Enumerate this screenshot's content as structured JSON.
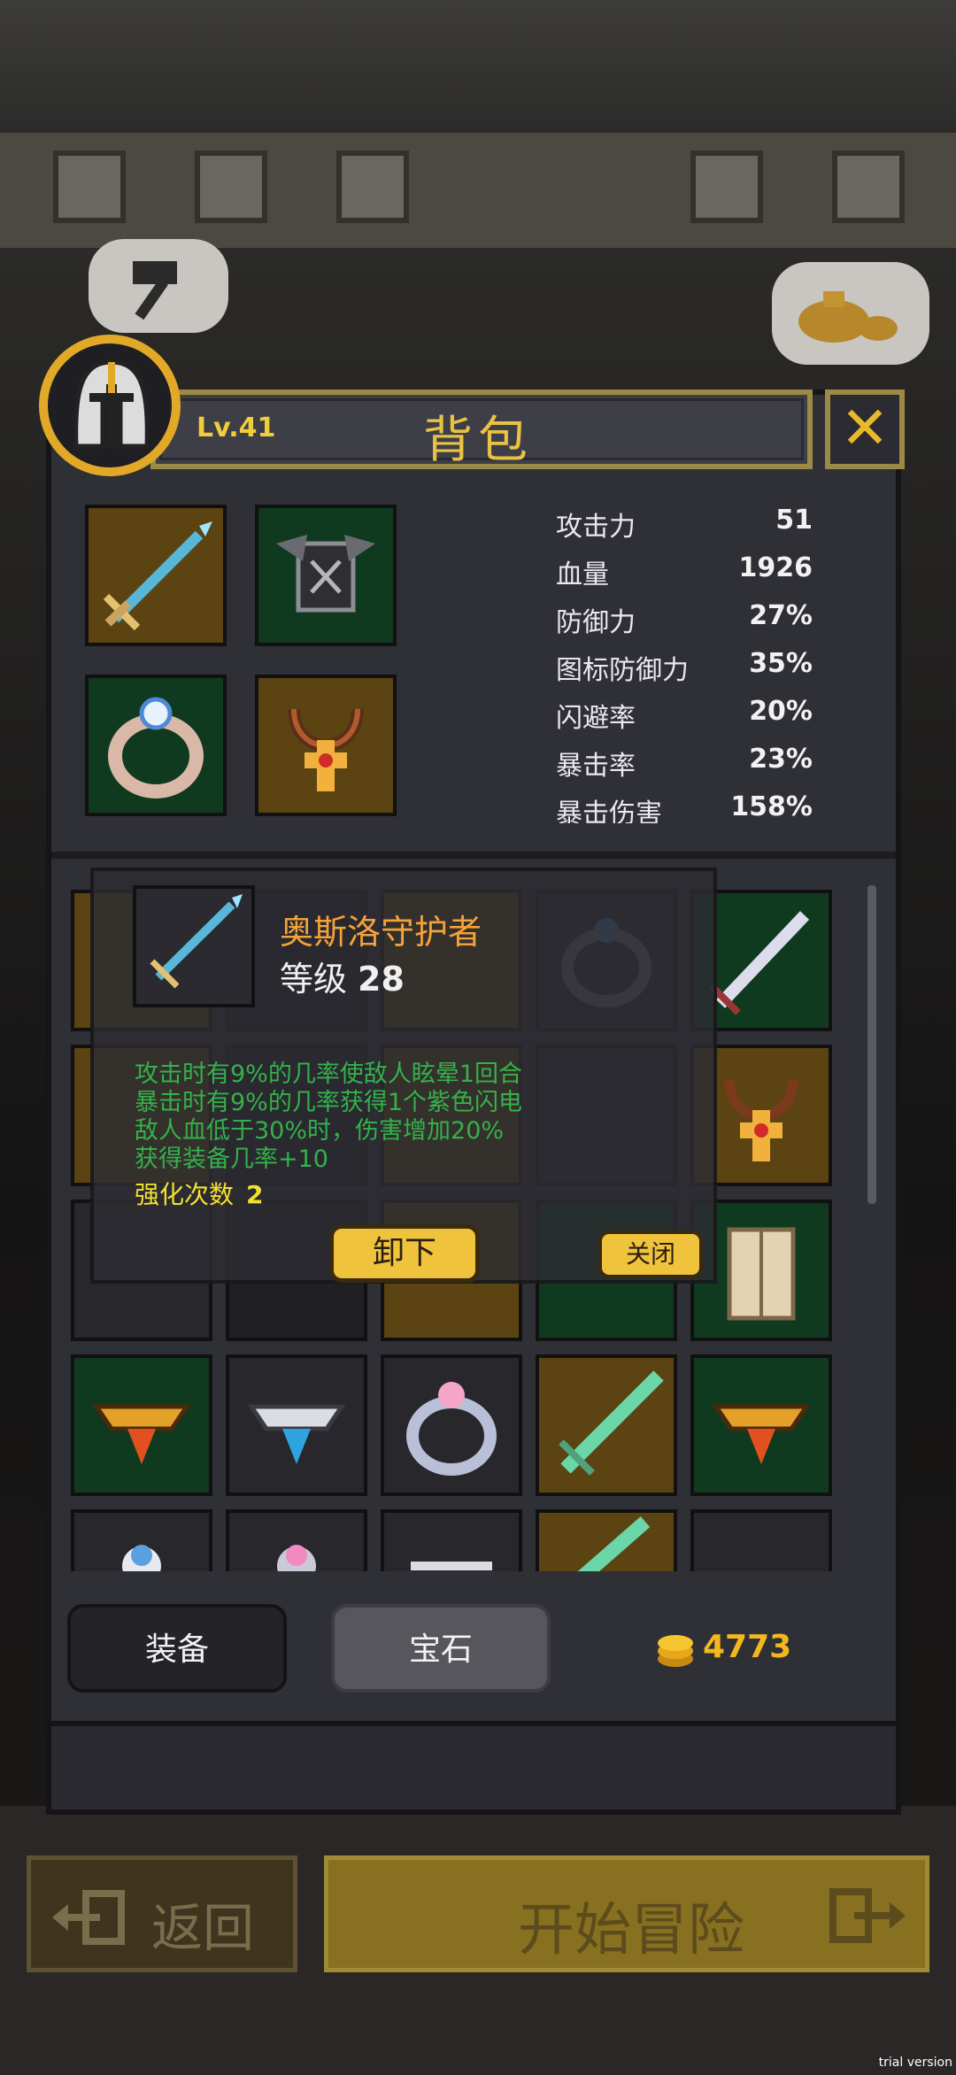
{
  "header": {
    "level": "Lv.41",
    "title": "背包",
    "close_icon": "close-x-icon"
  },
  "equipped": [
    {
      "name": "spear",
      "icon": "spear-icon",
      "bg": "gold"
    },
    {
      "name": "armor",
      "icon": "dark-armor-icon",
      "bg": "green"
    },
    {
      "name": "ring",
      "icon": "ring-icon",
      "bg": "green"
    },
    {
      "name": "amulet",
      "icon": "amulet-icon",
      "bg": "gold"
    }
  ],
  "stats": [
    {
      "label": "攻击力",
      "value": "51"
    },
    {
      "label": "血量",
      "value": "1926"
    },
    {
      "label": "防御力",
      "value": "27%"
    },
    {
      "label": "图标防御力",
      "value": "35%"
    },
    {
      "label": "闪避率",
      "value": "20%"
    },
    {
      "label": "暴击率",
      "value": "23%"
    },
    {
      "label": "暴击伤害",
      "value": "158%"
    }
  ],
  "tooltip": {
    "item_name": "奥斯洛守护者",
    "level_label": "等级",
    "level_value": "28",
    "effects": [
      "攻击时有9%的几率使敌人眩晕1回合",
      "暴击时有9%的几率获得1个紫色闪电",
      "敌人血低于30%时，伤害增加20%",
      "获得装备几率+10"
    ],
    "upgrade_label": "强化次数",
    "upgrade_value": "2",
    "unequip_label": "卸下",
    "close_label": "关闭"
  },
  "tabs": {
    "equipment": "装备",
    "gems": "宝石"
  },
  "gold": "4773",
  "footer": {
    "back_label": "返回",
    "start_label": "开始冒险"
  },
  "watermark": "trial version",
  "colors": {
    "accent_gold": "#f0c33d",
    "effect_green": "#34b14a",
    "item_name_orange": "#f4a23a",
    "panel_bg": "#2f2f36"
  }
}
